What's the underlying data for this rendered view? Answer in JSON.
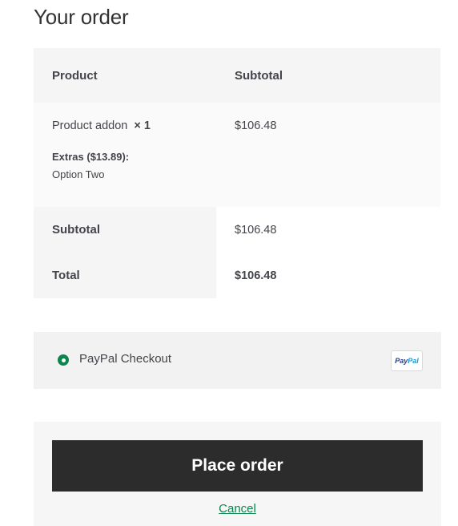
{
  "heading": "Your order",
  "table": {
    "head": {
      "product": "Product",
      "subtotal": "Subtotal"
    },
    "item": {
      "name": "Product addon",
      "qty": "× 1",
      "meta_key": "Extras ($13.89):",
      "meta_value": "Option Two",
      "subtotal": "$106.48"
    },
    "totals": {
      "subtotal_label": "Subtotal",
      "subtotal_value": "$106.48",
      "total_label": "Total",
      "total_value": "$106.48"
    }
  },
  "payment": {
    "method_label": "PayPal Checkout",
    "selected": true,
    "logo_text_a": "Pay",
    "logo_text_b": "Pal",
    "radio_color": "#0f834d"
  },
  "actions": {
    "place_order": "Place order",
    "cancel": "Cancel",
    "link_color": "#0f834d"
  }
}
